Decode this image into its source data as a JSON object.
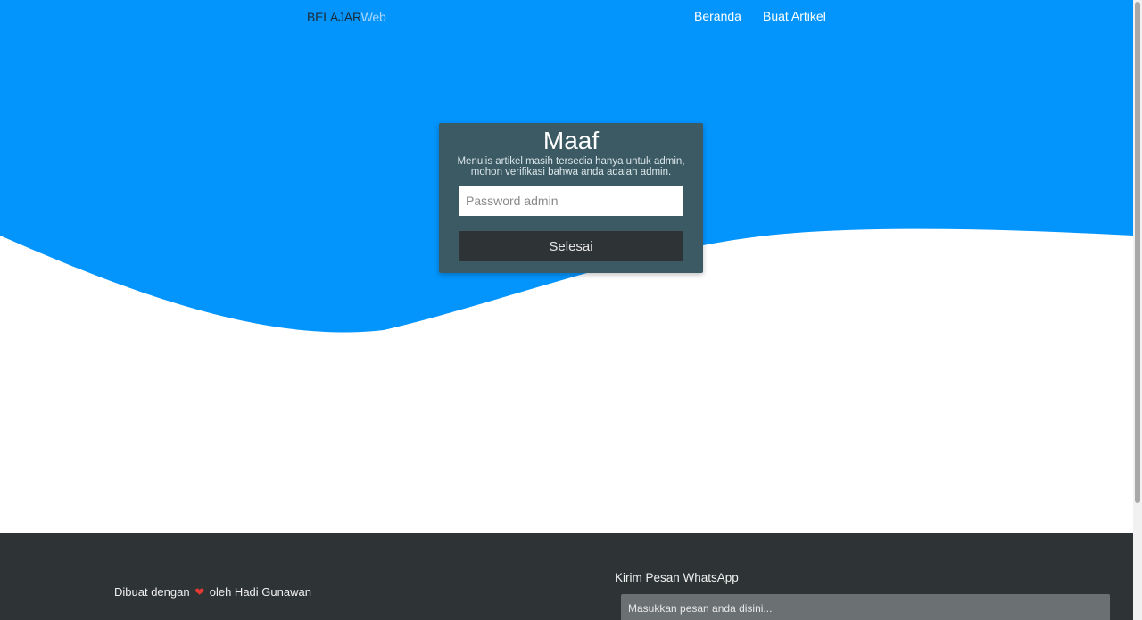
{
  "colors": {
    "hero_blue": "#0394fc",
    "card_bg": "#3c5a63",
    "button_bg": "#2e3435",
    "footer_bg": "#2e3435"
  },
  "navbar": {
    "brand_part1": "BELAJAR",
    "brand_part2": "Web",
    "links": [
      {
        "label": "Beranda"
      },
      {
        "label": "Buat Artikel"
      }
    ]
  },
  "card": {
    "title": "Maaf",
    "message": "Menulis artikel masih tersedia hanya untuk admin, mohon verifikasi bahwa anda adalah admin.",
    "password_placeholder": "Password admin",
    "password_value": "",
    "submit_label": "Selesai"
  },
  "footer": {
    "credit_prefix": "Dibuat dengan",
    "credit_suffix": "oleh Hadi Gunawan",
    "heart_icon": "heart-icon",
    "whatsapp_title": "Kirim Pesan WhatsApp",
    "whatsapp_placeholder": "Masukkan pesan anda disini..."
  }
}
